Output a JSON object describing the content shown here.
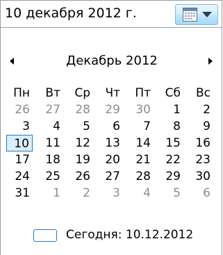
{
  "date_field": {
    "value": "10 декабря  2012 г."
  },
  "calendar": {
    "month_title": "Декабрь 2012",
    "weekdays": [
      "Пн",
      "Вт",
      "Ср",
      "Чт",
      "Пт",
      "Сб",
      "Вс"
    ],
    "weeks": [
      [
        "26",
        "27",
        "28",
        "29",
        "30",
        "1",
        "2"
      ],
      [
        "3",
        "4",
        "5",
        "6",
        "7",
        "8",
        "9"
      ],
      [
        "10",
        "11",
        "12",
        "13",
        "14",
        "15",
        "16"
      ],
      [
        "17",
        "18",
        "19",
        "20",
        "21",
        "22",
        "23"
      ],
      [
        "24",
        "25",
        "26",
        "27",
        "28",
        "29",
        "30"
      ],
      [
        "31",
        "1",
        "2",
        "3",
        "4",
        "5",
        "6"
      ]
    ],
    "today_label": "Сегодня: 10.12.2012"
  },
  "colors": {
    "selection_border": "#2478c4",
    "other_month_text": "#8d8d8d"
  }
}
